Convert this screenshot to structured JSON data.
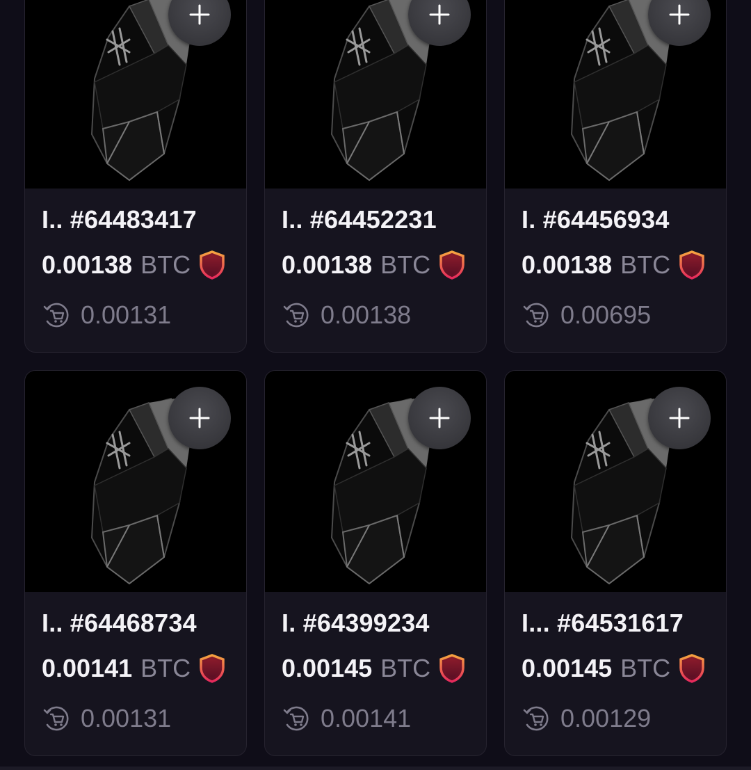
{
  "items": [
    {
      "name": "I.. #64483417",
      "price": "0.00138",
      "currency": "BTC",
      "last_sale": "0.00131"
    },
    {
      "name": "I.. #64452231",
      "price": "0.00138",
      "currency": "BTC",
      "last_sale": "0.00138"
    },
    {
      "name": "I. #64456934",
      "price": "0.00138",
      "currency": "BTC",
      "last_sale": "0.00695"
    },
    {
      "name": "I.. #64468734",
      "price": "0.00141",
      "currency": "BTC",
      "last_sale": "0.00131"
    },
    {
      "name": "I. #64399234",
      "price": "0.00145",
      "currency": "BTC",
      "last_sale": "0.00141"
    },
    {
      "name": "I... #64531617",
      "price": "0.00145",
      "currency": "BTC",
      "last_sale": "0.00129"
    }
  ],
  "icons": {
    "add": "plus-icon",
    "verified": "shield-icon",
    "last_sale": "cart-refresh-icon"
  },
  "colors": {
    "background": "#0f0d18",
    "card": "#16141f",
    "shield_gradient_top": "#f29a3a",
    "shield_gradient_bottom": "#e2265a"
  }
}
